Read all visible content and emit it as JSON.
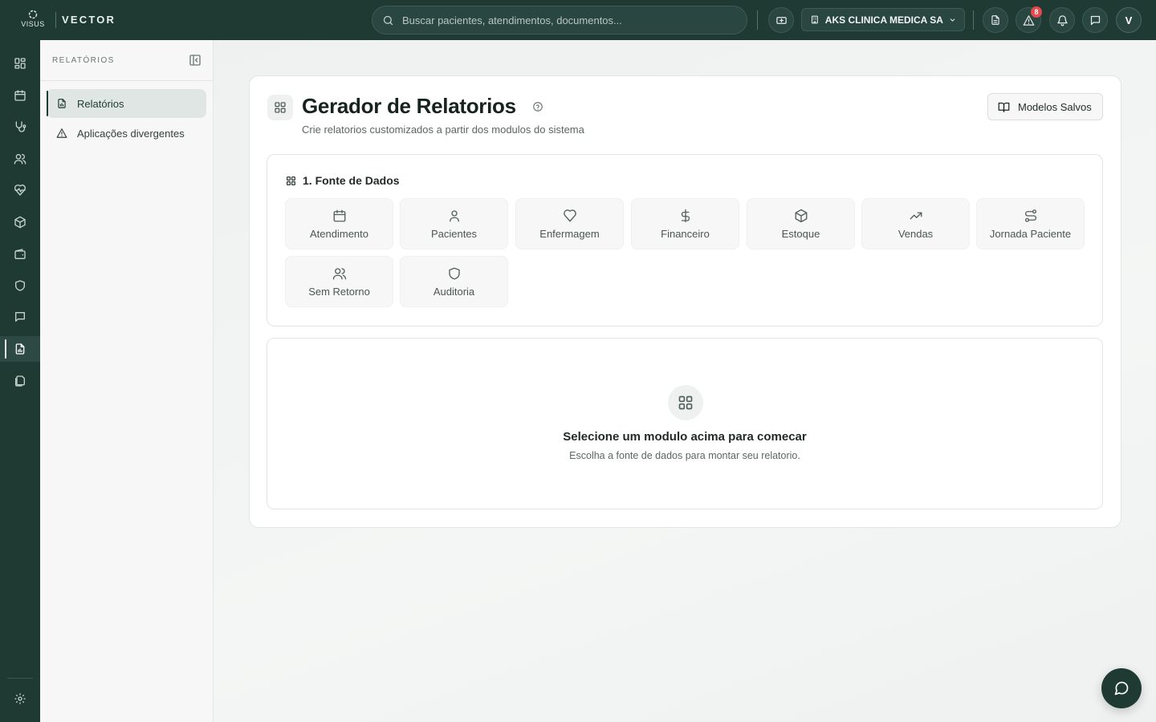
{
  "topbar": {
    "logo_text": "VISUS",
    "brand": "VECTOR",
    "search_placeholder": "Buscar pacientes, atendimentos, documentos...",
    "clinic_name": "AKS CLINICA MEDICA SA",
    "alerts_badge": "8",
    "avatar_initial": "V"
  },
  "rail": {
    "items": [
      "dashboard-icon",
      "calendar-icon",
      "stethoscope-icon",
      "users-icon",
      "heart-pulse-icon",
      "package-icon",
      "wallet-icon",
      "shield-icon",
      "message-icon",
      "report-icon",
      "files-icon"
    ],
    "active": "report-icon"
  },
  "subsidebar": {
    "title": "RELATÓRIOS",
    "items": [
      {
        "label": "Relatórios",
        "icon": "report-icon",
        "active": true
      },
      {
        "label": "Aplicações divergentes",
        "icon": "warning-icon",
        "active": false
      }
    ]
  },
  "main": {
    "title": "Gerador de Relatorios",
    "subtitle": "Crie relatorios customizados a partir dos modulos do sistema",
    "saved_models_label": "Modelos Salvos",
    "data_source": {
      "title": "1. Fonte de Dados",
      "modules": [
        {
          "label": "Atendimento",
          "icon": "calendar-icon"
        },
        {
          "label": "Pacientes",
          "icon": "user-icon"
        },
        {
          "label": "Enfermagem",
          "icon": "heart-icon"
        },
        {
          "label": "Financeiro",
          "icon": "dollar-icon"
        },
        {
          "label": "Estoque",
          "icon": "package-icon"
        },
        {
          "label": "Vendas",
          "icon": "trending-up-icon"
        },
        {
          "label": "Jornada Paciente",
          "icon": "route-icon"
        },
        {
          "label": "Sem Retorno",
          "icon": "users-icon"
        },
        {
          "label": "Auditoria",
          "icon": "shield-icon"
        }
      ]
    },
    "empty_state": {
      "title": "Selecione um modulo acima para comecar",
      "subtitle": "Escolha a fonte de dados para montar seu relatorio."
    }
  },
  "colors": {
    "primary": "#1f3a33",
    "badge": "#e5484d"
  }
}
